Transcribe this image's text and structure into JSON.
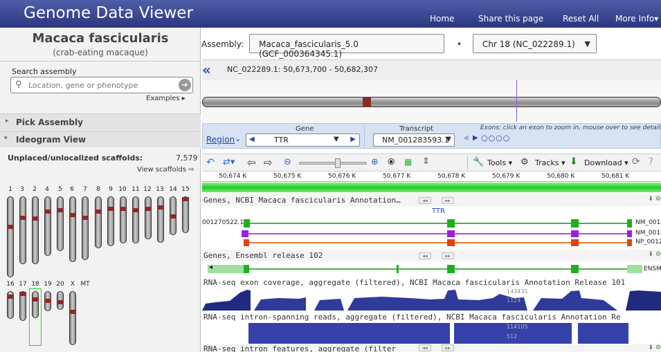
{
  "header": {
    "title": "Genome Data Viewer",
    "nav": [
      "Home",
      "Share this page",
      "Reset All",
      "More Info"
    ]
  },
  "organism": {
    "name": "Macaca fascicularis",
    "common": "(crab-eating macaque)"
  },
  "assembly": {
    "label": "Assembly:",
    "value": "Macaca_fascicularis_5.0 (GCF_000364345.1)",
    "chromosome": "Chr 18 (NC_022289.1)"
  },
  "search": {
    "label": "Search assembly",
    "placeholder": "Location, gene or phenotype",
    "examples": "Examples"
  },
  "panels": {
    "pick": "Pick Assembly",
    "ideogram": "Ideogram View"
  },
  "unplaced": {
    "label": "Unplaced/unlocalized scaffolds:",
    "count": "7,579",
    "link": "View scaffolds"
  },
  "chromosomes": {
    "row1": [
      "1",
      "3",
      "2",
      "4",
      "5",
      "6",
      "7",
      "8",
      "9",
      "10",
      "11",
      "12",
      "13",
      "14",
      "15"
    ],
    "row2": [
      "16",
      "17",
      "18",
      "19",
      "20",
      "X",
      "MT"
    ],
    "selected": "18"
  },
  "location": "NC_022289.1: 50,673,700 - 50,682,307",
  "nav_bar": {
    "region": "Region",
    "gene_label": "Gene",
    "gene": "TTR",
    "transcript_label": "Transcript",
    "transcript": "NM_001283593.1",
    "hint": "Exons: click an exon to zoom in, mouse over to see details"
  },
  "toolbar": {
    "tools": "Tools",
    "tracks": "Tracks",
    "download": "Download"
  },
  "ruler": [
    "50,674 K",
    "50,675 K",
    "50,676 K",
    "50,677 K",
    "50,678 K",
    "50,679 K",
    "50,680 K",
    "50,681 K"
  ],
  "tracks": {
    "ncbi_genes": "Genes, NCBI Macaca fascicularis Annotation…",
    "ttr": "TTR",
    "left_acc": "001270522.1",
    "right_accs": [
      "NM_0012",
      "NM_0012",
      "NP_0012"
    ],
    "ensembl": "Genes, Ensembl release 102",
    "ens_acc": "ENSM",
    "rna_exon": "RNA-seq exon coverage, aggregate (filtered), NCBI Macaca fascicularis Annotation Release 101",
    "exon_val1": "143431",
    "exon_val2": "1124",
    "rna_intron": "RNA-seq intron-spanning reads, aggregate (filtered), NCBI Macaca fascicularis Annotation Re",
    "intron_val1": "114105",
    "intron_val2": "512",
    "rna_feat": "RNA-seq intron features, aggregate (filter"
  }
}
